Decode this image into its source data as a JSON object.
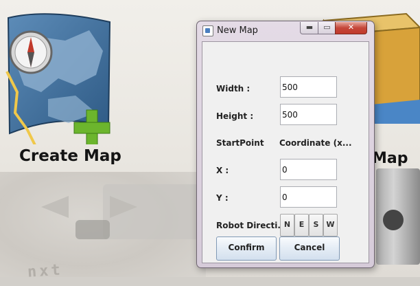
{
  "background": {
    "create_map_label": "Create Map",
    "right_label": "Map",
    "brick_text": "nxt"
  },
  "dialog": {
    "title": "New Map",
    "title_buttons": {
      "minimize": "▬",
      "maximize": "▭",
      "close": "✕"
    },
    "width_label": "Width :",
    "width_value": "500",
    "height_label": "Height :",
    "height_value": "500",
    "startpoint_label": "StartPoint",
    "coordinate_label": "Coordinate (x...",
    "x_label": "X :",
    "x_value": "0",
    "y_label": "Y :",
    "y_value": "0",
    "direction_label": "Robot Directi...",
    "directions": [
      "N",
      "E",
      "S",
      "W"
    ],
    "confirm_label": "Confirm",
    "cancel_label": "Cancel"
  },
  "colors": {
    "close_button": "#c0392b",
    "map_sea": "#3d6f9e",
    "plus_green": "#6cb52d"
  }
}
